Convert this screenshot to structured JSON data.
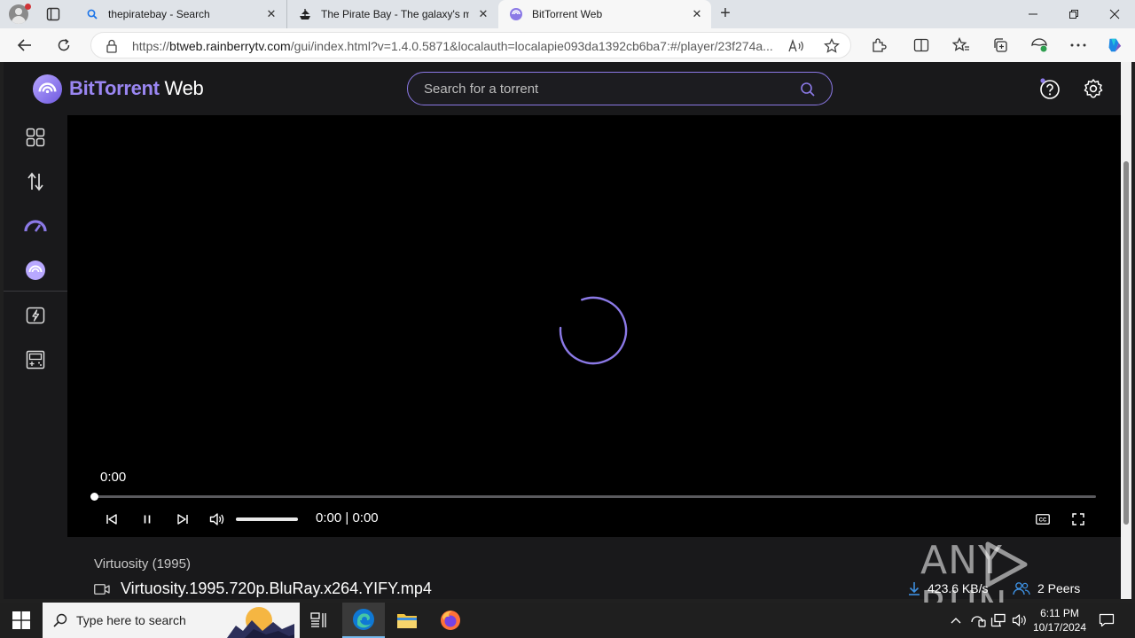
{
  "browser": {
    "tabs": [
      {
        "title": "thepiratebay - Search",
        "favicon": "search-icon"
      },
      {
        "title": "The Pirate Bay - The galaxy's most resilient BitTorrent site",
        "favicon": "pirate-ship-icon"
      },
      {
        "title": "BitTorrent Web",
        "favicon": "bittorrent-icon",
        "active": true
      }
    ],
    "address": {
      "scheme": "https://",
      "host": "btweb.rainberrytv.com",
      "path": "/gui/index.html?v=1.4.0.5871&localauth=localapie093da1392cb6ba7:#/player/23f274a..."
    }
  },
  "app": {
    "brand": {
      "bit": "Bit",
      "torrent": "Torrent",
      "web": " Web"
    },
    "search": {
      "placeholder": "Search for a torrent"
    },
    "sidebar": [
      "dashboard-icon",
      "transfers-icon",
      "speed-icon",
      "bittorrent-icon",
      "power-icon",
      "games-icon"
    ],
    "player": {
      "time_display": "0:00",
      "current_time": "0:00",
      "duration": "0:00",
      "progress": 0,
      "volume": 1.0
    },
    "media": {
      "title": "Virtuosity (1995)",
      "file": "Virtuosity.1995.720p.BluRay.x264.YIFY.mp4",
      "download_speed": "423.6 KB/s",
      "peers": "2 Peers"
    }
  },
  "watermark": {
    "left": "ANY",
    "right": "RUN"
  },
  "taskbar": {
    "search_placeholder": "Type here to search",
    "time": "6:11 PM",
    "date": "10/17/2024"
  },
  "colors": {
    "accent": "#8b79e6",
    "app_bg": "#19191b",
    "player_bg": "#000000"
  }
}
